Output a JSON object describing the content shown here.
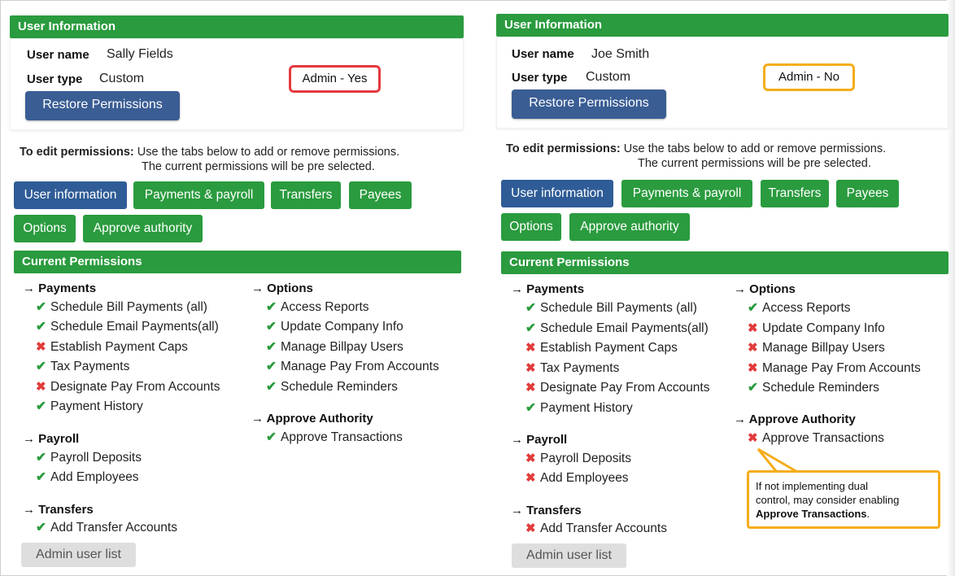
{
  "left": {
    "header": "User Information",
    "user_name_label": "User name",
    "user_name": "Sally Fields",
    "user_type_label": "User type",
    "user_type": "Custom",
    "restore_label": "Restore Permissions",
    "admin_callout": "Admin - Yes",
    "edit_bold": "To edit permissions:",
    "edit_line1": " Use the tabs below to add or remove permissions.",
    "edit_line2": "The current permissions will be pre selected.",
    "tabs": [
      "User information",
      "Payments & payroll",
      "Transfers",
      "Payees",
      "Options",
      "Approve authority"
    ],
    "current_header": "Current Permissions",
    "payments_head": "→ Payments",
    "payments": [
      {
        "label": "Schedule Bill Payments (all)",
        "ok": true
      },
      {
        "label": "Schedule Email Payments(all)",
        "ok": true
      },
      {
        "label": "Establish Payment Caps",
        "ok": false
      },
      {
        "label": "Tax Payments",
        "ok": true
      },
      {
        "label": "Designate Pay From Accounts",
        "ok": false
      },
      {
        "label": "Payment History",
        "ok": true
      }
    ],
    "payroll_head": "→ Payroll",
    "payroll": [
      {
        "label": "Payroll Deposits",
        "ok": true
      },
      {
        "label": "Add Employees",
        "ok": true
      }
    ],
    "transfers_head": "→ Transfers",
    "transfers": [
      {
        "label": "Add Transfer Accounts",
        "ok": true
      }
    ],
    "options_head": "→ Options",
    "options": [
      {
        "label": "Access Reports",
        "ok": true
      },
      {
        "label": "Update Company Info",
        "ok": true
      },
      {
        "label": "Manage Billpay Users",
        "ok": true
      },
      {
        "label": "Manage Pay From Accounts",
        "ok": true
      },
      {
        "label": "Schedule Reminders",
        "ok": true
      }
    ],
    "approve_head": "→ Approve Authority",
    "approve": [
      {
        "label": "Approve Transactions",
        "ok": true
      }
    ],
    "admin_list": "Admin user list"
  },
  "right": {
    "header": "User Information",
    "user_name_label": "User name",
    "user_name": "Joe Smith",
    "user_type_label": "User type",
    "user_type": "Custom",
    "restore_label": "Restore Permissions",
    "admin_callout": "Admin - No",
    "edit_bold": "To edit permissions:",
    "edit_line1": " Use the tabs below to add or remove permissions.",
    "edit_line2": "The current permissions will be pre selected.",
    "tabs": [
      "User information",
      "Payments & payroll",
      "Transfers",
      "Payees",
      "Options",
      "Approve authority"
    ],
    "current_header": "Current Permissions",
    "payments_head": "→ Payments",
    "payments": [
      {
        "label": "Schedule Bill Payments (all)",
        "ok": true
      },
      {
        "label": "Schedule Email Payments(all)",
        "ok": true
      },
      {
        "label": "Establish Payment Caps",
        "ok": false
      },
      {
        "label": "Tax Payments",
        "ok": false
      },
      {
        "label": "Designate Pay From Accounts",
        "ok": false
      },
      {
        "label": "Payment History",
        "ok": true
      }
    ],
    "payroll_head": "→ Payroll",
    "payroll": [
      {
        "label": "Payroll Deposits",
        "ok": false
      },
      {
        "label": "Add Employees",
        "ok": false
      }
    ],
    "transfers_head": "→ Transfers",
    "transfers": [
      {
        "label": "Add Transfer Accounts",
        "ok": false
      }
    ],
    "options_head": "→ Options",
    "options": [
      {
        "label": "Access Reports",
        "ok": true
      },
      {
        "label": "Update Company Info",
        "ok": false
      },
      {
        "label": "Manage Billpay Users",
        "ok": false
      },
      {
        "label": "Manage Pay From Accounts",
        "ok": false
      },
      {
        "label": "Schedule Reminders",
        "ok": true
      }
    ],
    "approve_head": "→ Approve Authority",
    "approve": [
      {
        "label": "Approve Transactions",
        "ok": false
      }
    ],
    "tip_line1": "If not implementing dual",
    "tip_line2": "control, may consider enabling",
    "tip_bold": "Approve Transactions",
    "tip_end": ".",
    "admin_list": "Admin user list"
  },
  "colors": {
    "green": "#2a9b3e",
    "blue": "#2f5c96",
    "check": "#2a9b3e",
    "cross": "#e23a3a",
    "callout_yes": "#e5393f",
    "callout_no": "#f5ad1a"
  },
  "icons": {
    "check": "✔",
    "cross": "✖"
  }
}
